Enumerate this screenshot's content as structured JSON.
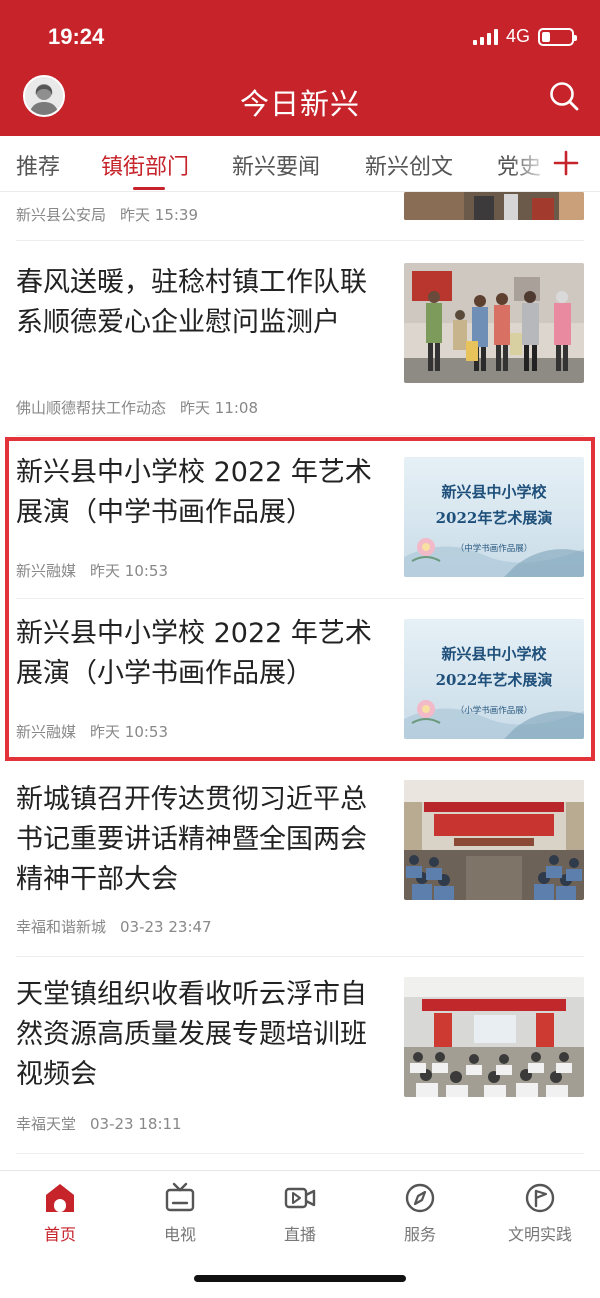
{
  "status_bar": {
    "time": "19:24",
    "network": "4G",
    "battery_level": 0.3
  },
  "header": {
    "title": "今日新兴"
  },
  "tabs": [
    {
      "label": "推荐",
      "active": false
    },
    {
      "label": "镇街部门",
      "active": true
    },
    {
      "label": "新兴要闻",
      "active": false
    },
    {
      "label": "新兴创文",
      "active": false
    },
    {
      "label": "党史",
      "active": false
    }
  ],
  "feed": {
    "partial_top": {
      "source": "新兴县公安局",
      "time": "昨天 15:39"
    },
    "articles": [
      {
        "title": "春风送暖，驻稔村镇工作队联系顺德爱心企业慰问监测户",
        "source": "佛山顺德帮扶工作动态",
        "time": "昨天 11:08"
      },
      {
        "title": "新兴县中小学校 2022 年艺术展演（中学书画作品展）",
        "source": "新兴融媒",
        "time": "昨天 10:53",
        "poster": {
          "line1": "新兴县中小学校",
          "line2": "2022年艺术展演",
          "line3": "（中学书画作品展）"
        }
      },
      {
        "title": "新兴县中小学校 2022 年艺术展演（小学书画作品展）",
        "source": "新兴融媒",
        "time": "昨天 10:53",
        "poster": {
          "line1": "新兴县中小学校",
          "line2": "2022年艺术展演",
          "line3": "（小学书画作品展）"
        }
      },
      {
        "title": "新城镇召开传达贯彻习近平总书记重要讲话精神暨全国两会精神干部大会",
        "source": "幸福和谐新城",
        "time": "03-23 23:47"
      },
      {
        "title": "天堂镇组织收看收听云浮市自然资源高质量发展专题培训班视频会",
        "source": "幸福天堂",
        "time": "03-23 18:11"
      }
    ]
  },
  "bottom_nav": [
    {
      "label": "首页",
      "icon": "home-icon",
      "active": true
    },
    {
      "label": "电视",
      "icon": "tv-icon",
      "active": false
    },
    {
      "label": "直播",
      "icon": "live-video-icon",
      "active": false
    },
    {
      "label": "服务",
      "icon": "compass-icon",
      "active": false
    },
    {
      "label": "文明实践",
      "icon": "flag-icon",
      "active": false
    }
  ],
  "colors": {
    "brand": "#c6232a",
    "highlight": "#e2333b",
    "text": "#222222",
    "meta": "#888888"
  }
}
